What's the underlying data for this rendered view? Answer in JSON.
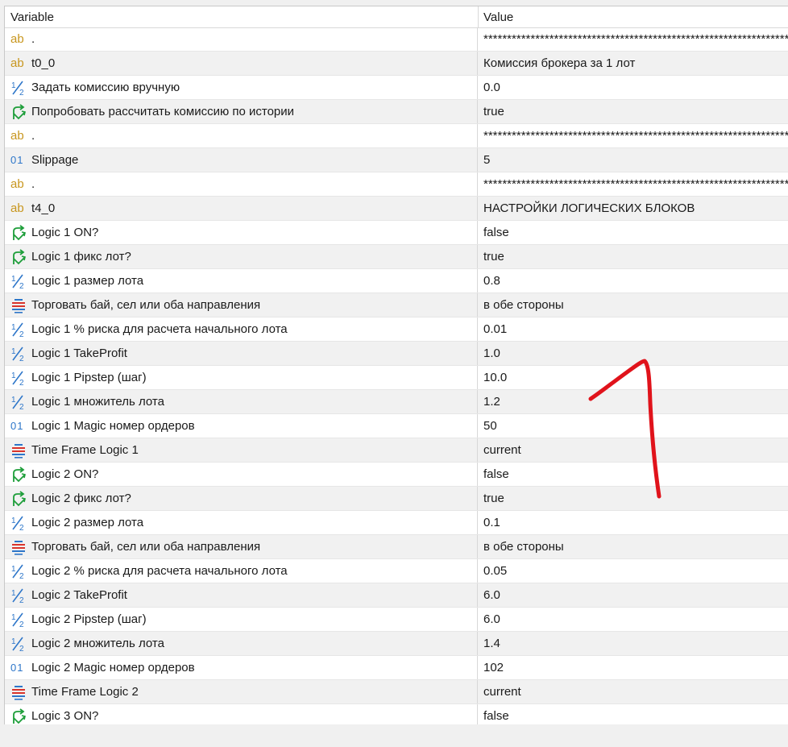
{
  "header": {
    "variable_label": "Variable",
    "value_label": "Value"
  },
  "rows": [
    {
      "type": "string",
      "icon": "ab-text-icon",
      "name": ".",
      "value": "******************************************************************"
    },
    {
      "type": "string",
      "icon": "ab-text-icon",
      "name": "t0_0",
      "value": "Комиссия брокера за 1 лот"
    },
    {
      "type": "double",
      "icon": "half-fraction-icon",
      "name": "Задать комиссию вручную",
      "value": "0.0"
    },
    {
      "type": "bool",
      "icon": "branch-arrow-icon",
      "name": "Попробовать рассчитать комиссию по истории",
      "value": "true"
    },
    {
      "type": "string",
      "icon": "ab-text-icon",
      "name": ".",
      "value": "******************************************************************"
    },
    {
      "type": "int",
      "icon": "integer-01-icon",
      "name": "Slippage",
      "value": "5"
    },
    {
      "type": "string",
      "icon": "ab-text-icon",
      "name": ".",
      "value": "******************************************************************"
    },
    {
      "type": "string",
      "icon": "ab-text-icon",
      "name": "t4_0",
      "value": "НАСТРОЙКИ ЛОГИЧЕСКИХ БЛОКОВ"
    },
    {
      "type": "bool",
      "icon": "branch-arrow-icon",
      "name": "Logic 1 ON?",
      "value": "false"
    },
    {
      "type": "bool",
      "icon": "branch-arrow-icon",
      "name": "Logic 1 фикс лот?",
      "value": "true"
    },
    {
      "type": "double",
      "icon": "half-fraction-icon",
      "name": "Logic 1 размер лота",
      "value": "0.8"
    },
    {
      "type": "enum",
      "icon": "enum-list-icon",
      "name": "Торговать бай, сел или оба направления",
      "value": "в обе стороны"
    },
    {
      "type": "double",
      "icon": "half-fraction-icon",
      "name": "Logic 1 % риска для расчета начального лота",
      "value": "0.01"
    },
    {
      "type": "double",
      "icon": "half-fraction-icon",
      "name": "Logic 1 TakeProfit",
      "value": "1.0"
    },
    {
      "type": "double",
      "icon": "half-fraction-icon",
      "name": "Logic 1 Pipstep (шаг)",
      "value": "10.0"
    },
    {
      "type": "double",
      "icon": "half-fraction-icon",
      "name": "Logic 1 множитель лота",
      "value": "1.2"
    },
    {
      "type": "int",
      "icon": "integer-01-icon",
      "name": "Logic 1 Magic номер ордеров",
      "value": "50"
    },
    {
      "type": "enum",
      "icon": "enum-list-icon",
      "name": "Time Frame Logic 1",
      "value": "current"
    },
    {
      "type": "bool",
      "icon": "branch-arrow-icon",
      "name": "Logic 2 ON?",
      "value": "false"
    },
    {
      "type": "bool",
      "icon": "branch-arrow-icon",
      "name": "Logic 2 фикс лот?",
      "value": "true"
    },
    {
      "type": "double",
      "icon": "half-fraction-icon",
      "name": "Logic 2 размер лота",
      "value": "0.1"
    },
    {
      "type": "enum",
      "icon": "enum-list-icon",
      "name": "Торговать бай, сел или оба направления",
      "value": "в обе стороны"
    },
    {
      "type": "double",
      "icon": "half-fraction-icon",
      "name": "Logic 2 % риска для расчета начального лота",
      "value": "0.05"
    },
    {
      "type": "double",
      "icon": "half-fraction-icon",
      "name": "Logic 2 TakeProfit",
      "value": "6.0"
    },
    {
      "type": "double",
      "icon": "half-fraction-icon",
      "name": "Logic 2 Pipstep (шаг)",
      "value": "6.0"
    },
    {
      "type": "double",
      "icon": "half-fraction-icon",
      "name": "Logic 2 множитель лота",
      "value": "1.4"
    },
    {
      "type": "int",
      "icon": "integer-01-icon",
      "name": "Logic 2 Magic номер ордеров",
      "value": "102"
    },
    {
      "type": "enum",
      "icon": "enum-list-icon",
      "name": "Time Frame Logic 2",
      "value": "current"
    },
    {
      "type": "bool",
      "icon": "branch-arrow-icon",
      "name": "Logic 3 ON?",
      "value": "false"
    }
  ],
  "icon_glyphs": {
    "ab": "ab",
    "o1": "01"
  },
  "colors": {
    "ab_icon": "#c8961e",
    "int_icon": "#2d76c9",
    "double_icon": "#2d76c9",
    "bool_icon": "#1e9e3a",
    "enum_icon_red": "#d9342b",
    "enum_icon_blue": "#2d76c9",
    "alt_row": "#f1f1f1",
    "annotation_stroke": "#e0131b"
  }
}
